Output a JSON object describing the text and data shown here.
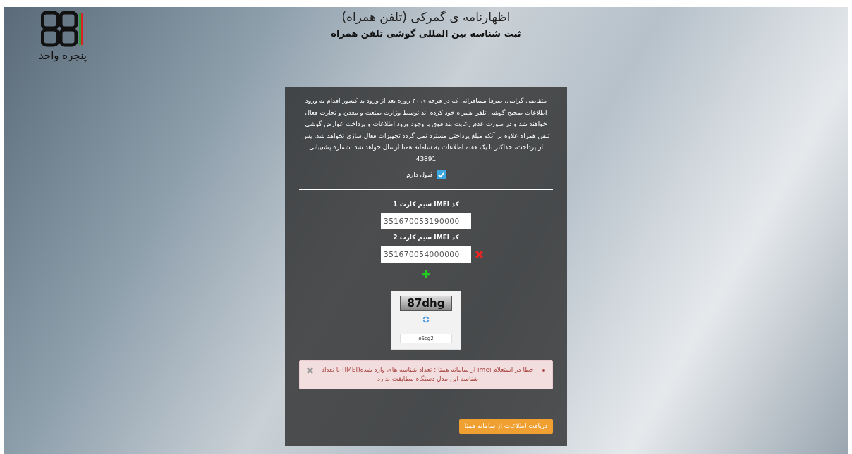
{
  "logo": {
    "text": "پنجره واحد"
  },
  "header": {
    "title": "اظهارنامه ی گمرکی (تلفن همراه)",
    "subtitle": "ثبت شناسه بین المللی گوشی تلفن همراه"
  },
  "notice": "متقاضی گرامی، صرفا مسافرانی که در فرجه ی ۳۰ روزه بعد از ورود به کشور اقدام به ورود اطلاعات صحیح گوشی تلفن همراه خود کرده اند توسط وزارت صنعت و معدن و تجارت فعال خواهند شد و در صورت عدم رعایت بند فوق با وجود ورود اطلاعات و پرداخت عوارض گوشی تلفن همراه علاوه بر آنکه مبلغ پرداختی مسترد نمی گردد تجهیزات فعال سازی نخواهد شد. پس از پرداخت، حداکثر تا یک هفته اطلاعات به سامانه همتا ارسال خواهد شد. شماره پشتیبانی 43891",
  "agree": {
    "label": "قبول دارم",
    "checked": true
  },
  "imei_fields": [
    {
      "label": "کد IMEI سیم کارت 1",
      "value": "351670053190000",
      "removable": false
    },
    {
      "label": "کد IMEI سیم کارت 2",
      "value": "351670054000000",
      "removable": true
    }
  ],
  "captcha": {
    "image_text": "87dhg",
    "value": "e6cg2"
  },
  "alert": {
    "message": "خطا در استعلام imei از سامانه همتا : تعداد شناسه های وارد شده(IMEI) با تعداد شناسه این مدل دستگاه مطابقت ندارد"
  },
  "submit_button": "دریافت اطلاعات از سامانه همتا"
}
